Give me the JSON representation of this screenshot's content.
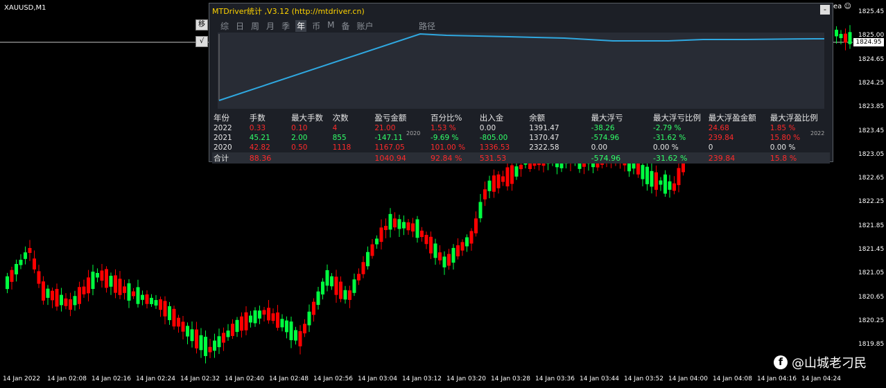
{
  "symbol": "XAUUSD,M1",
  "current_price": "1824.95",
  "price_ticks": [
    "1825.45",
    "1825.00",
    "1824.65",
    "1824.25",
    "1823.85",
    "1823.45",
    "1823.05",
    "1822.65",
    "1822.25",
    "1821.85",
    "1821.45",
    "1821.05",
    "1820.65",
    "1820.25",
    "1819.85"
  ],
  "time_ticks": [
    "14 Jan 2022",
    "14 Jan 02:08",
    "14 Jan 02:16",
    "14 Jan 02:24",
    "14 Jan 02:32",
    "14 Jan 02:40",
    "14 Jan 02:48",
    "14 Jan 02:56",
    "14 Jan 03:04",
    "14 Jan 03:12",
    "14 Jan 03:20",
    "14 Jan 03:28",
    "14 Jan 03:36",
    "14 Jan 03:44",
    "14 Jan 03:52",
    "14 Jan 04:00",
    "14 Jan 04:08",
    "14 Jan 04:16",
    "14 Jan 04:24"
  ],
  "left_buttons": [
    "移",
    "√"
  ],
  "panel": {
    "title": "MTDriver统计 ,V3.12 (http://mtdriver.cn)",
    "close_label": "-",
    "tabs": [
      "综",
      "日",
      "周",
      "月",
      "季",
      "年",
      "币",
      "M",
      "备",
      "账户"
    ],
    "active_tab": "年",
    "path_label": "路径",
    "year_start": "2020",
    "year_end": "2022",
    "headers": [
      "年份",
      "手数",
      "最大手数",
      "次数",
      "盈亏金额",
      "百分比%",
      "出入金",
      "余额",
      "最大浮亏",
      "最大浮亏比例",
      "最大浮盈金额",
      "最大浮盈比例"
    ],
    "rows": [
      [
        "2022",
        "0.33",
        "0.10",
        "4",
        "21.00",
        "1.53 %",
        "0.00",
        "1391.47",
        "-38.26",
        "-2.79 %",
        "24.68",
        "1.85 %"
      ],
      [
        "2021",
        "45.21",
        "2.00",
        "855",
        "-147.11",
        "-9.69 %",
        "-805.00",
        "1370.47",
        "-574.96",
        "-31.62 %",
        "239.84",
        "15.80 %"
      ],
      [
        "2020",
        "42.82",
        "0.50",
        "1118",
        "1167.05",
        "101.00 %",
        "1336.53",
        "2322.58",
        "0.00",
        "0.00 %",
        "0",
        "0.00 %"
      ]
    ],
    "total": [
      "合计",
      "88.36",
      "",
      "",
      "1040.94",
      "92.84 %",
      "531.53",
      "",
      "-574.96",
      "-31.62 %",
      "239.84",
      "15.8 %"
    ]
  },
  "watermark": {
    "text": "@山城老刁民",
    "logo": "f"
  },
  "colors": {
    "bull": "#00ff40",
    "bear": "#ff0000",
    "curve": "#2fa8e0",
    "bg": "#000000"
  }
}
